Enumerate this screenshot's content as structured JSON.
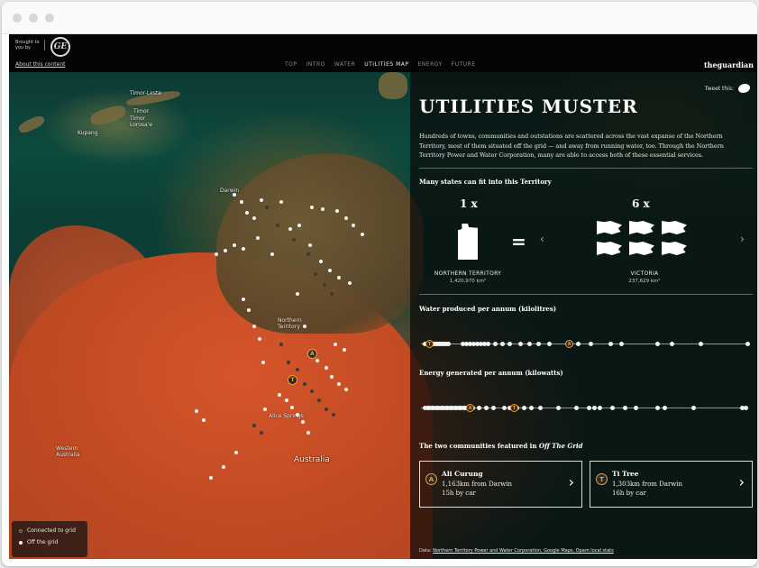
{
  "sponsor": {
    "label_line1": "Brought to",
    "label_line2": "you by",
    "logo_text": "GE"
  },
  "header": {
    "about_link": "About this content",
    "nav": [
      "TOP",
      "INTRO",
      "WATER",
      "UTILITIES MAP",
      "ENERGY",
      "FUTURE"
    ],
    "active_nav": "UTILITIES MAP",
    "brand": "theguardian"
  },
  "map": {
    "labels": {
      "timor_leste": "Timor-Leste",
      "timor": "Timor",
      "timor_lorosae": "Timor\nLorosa'e",
      "kupang": "Kupang",
      "darwin": "Darwin",
      "northern_territory": "Northern\nTerritory",
      "alice_springs": "Alice Springs",
      "western_australia": "Western\nAustralia",
      "australia": "Australia"
    },
    "legend": {
      "connected": "Connected to grid",
      "off_grid": "Off the grid"
    },
    "colors": {
      "off_grid": "#f3f3f3",
      "connected": "#3a3a3a",
      "marker": "#f39c2c"
    }
  },
  "panel": {
    "tweet_label": "Tweet this:",
    "title": "UTILITIES MUSTER",
    "intro": "Hundreds of towns, communities and outstations are scattered across the vast expanse of the Northern Territory, most of them situated off the grid — and away from running water, too. Through the Northern Territory Power and Water Corporation, many are able to access both of these essential services.",
    "states_heading": "Many states can fit into this Territory",
    "comparison": {
      "left_count": "1 x",
      "left_name": "NORTHERN TERRITORY",
      "left_area": "1,420,970 km²",
      "equals": "=",
      "right_count": "6 x",
      "right_name": "VICTORIA",
      "right_area": "237,629 km²",
      "prev": "‹",
      "next": "›"
    },
    "water_heading": "Water produced per annum (kilolitres)",
    "energy_heading": "Energy generated per annum (kilowatts)",
    "communities_heading_prefix": "The two communities featured in ",
    "communities_heading_em": "Off The Grid",
    "cards": [
      {
        "marker": "A",
        "name": "Ali Curung",
        "distance": "1,163km from Darwin",
        "time": "15h by car",
        "arrow": "›"
      },
      {
        "marker": "T",
        "name": "Ti Tree",
        "distance": "1,303km from Darwin",
        "time": "16h by car",
        "arrow": "›"
      }
    ],
    "sources_label": "Data: ",
    "sources_links": "Northern Territory Power and Water Corporation, Google Maps, Opam local stats"
  },
  "icons": {
    "twitter": "twitter-bird-icon",
    "ge": "ge-logo-icon",
    "chevron_left": "chevron-left-icon",
    "chevron_right": "chevron-right-icon"
  }
}
